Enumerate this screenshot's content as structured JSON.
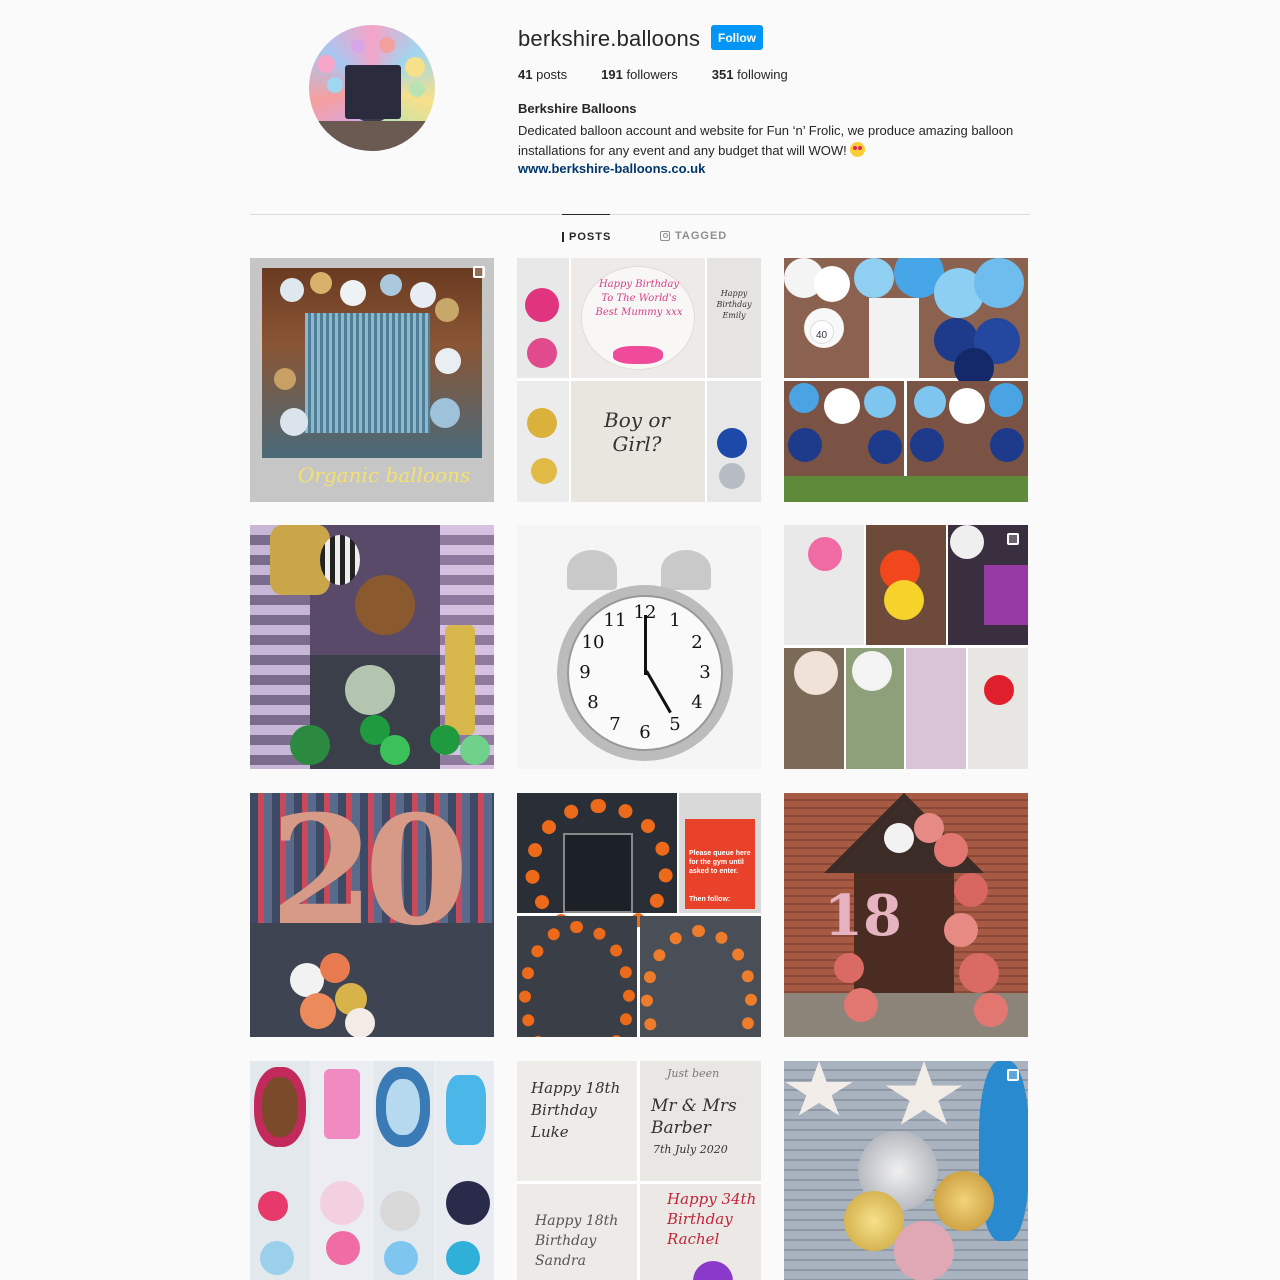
{
  "profile": {
    "username": "berkshire.balloons",
    "follow_label": "Follow",
    "posts_count": "41",
    "posts_label": "posts",
    "followers_count": "191",
    "followers_label": "followers",
    "following_count": "351",
    "following_label": "following",
    "full_name": "Berkshire Balloons",
    "bio": "Dedicated balloon account and website for Fun ‘n’ Frolic, we produce amazing balloon installations for any event and any budget that will WOW!",
    "emoji_icon": "star-struck-emoji-icon",
    "website": "www.berkshire-balloons.co.uk"
  },
  "tabs": {
    "posts": "POSTS",
    "tagged": "TAGGED"
  },
  "posts": {
    "p1_caption": "Organic balloons",
    "p2_text_a": "Happy Birthday To The World's Best Mummy xxx",
    "p2_text_b": "Happy Birthday Emily",
    "p2_text_c": "Boy or Girl?",
    "p3_number": "40",
    "p5_clock_numbers": [
      "12",
      "1",
      "2",
      "3",
      "4",
      "5",
      "6",
      "7",
      "8",
      "9",
      "10",
      "11"
    ],
    "p7_number": "20",
    "p8_sign": "Please queue here for the gym until asked to enter.",
    "p8_sign_b": "Then follow:",
    "p9_number": "18",
    "p11_a": "Happy 18th Birthday Luke",
    "p11_b": "Mr & Mrs Barber",
    "p11_c": "Happy 18th Birthday Sandra",
    "p11_d": "Happy 34th Birthday Rachel",
    "p11_e": "Just been",
    "p11_f": "7th July 2020"
  }
}
